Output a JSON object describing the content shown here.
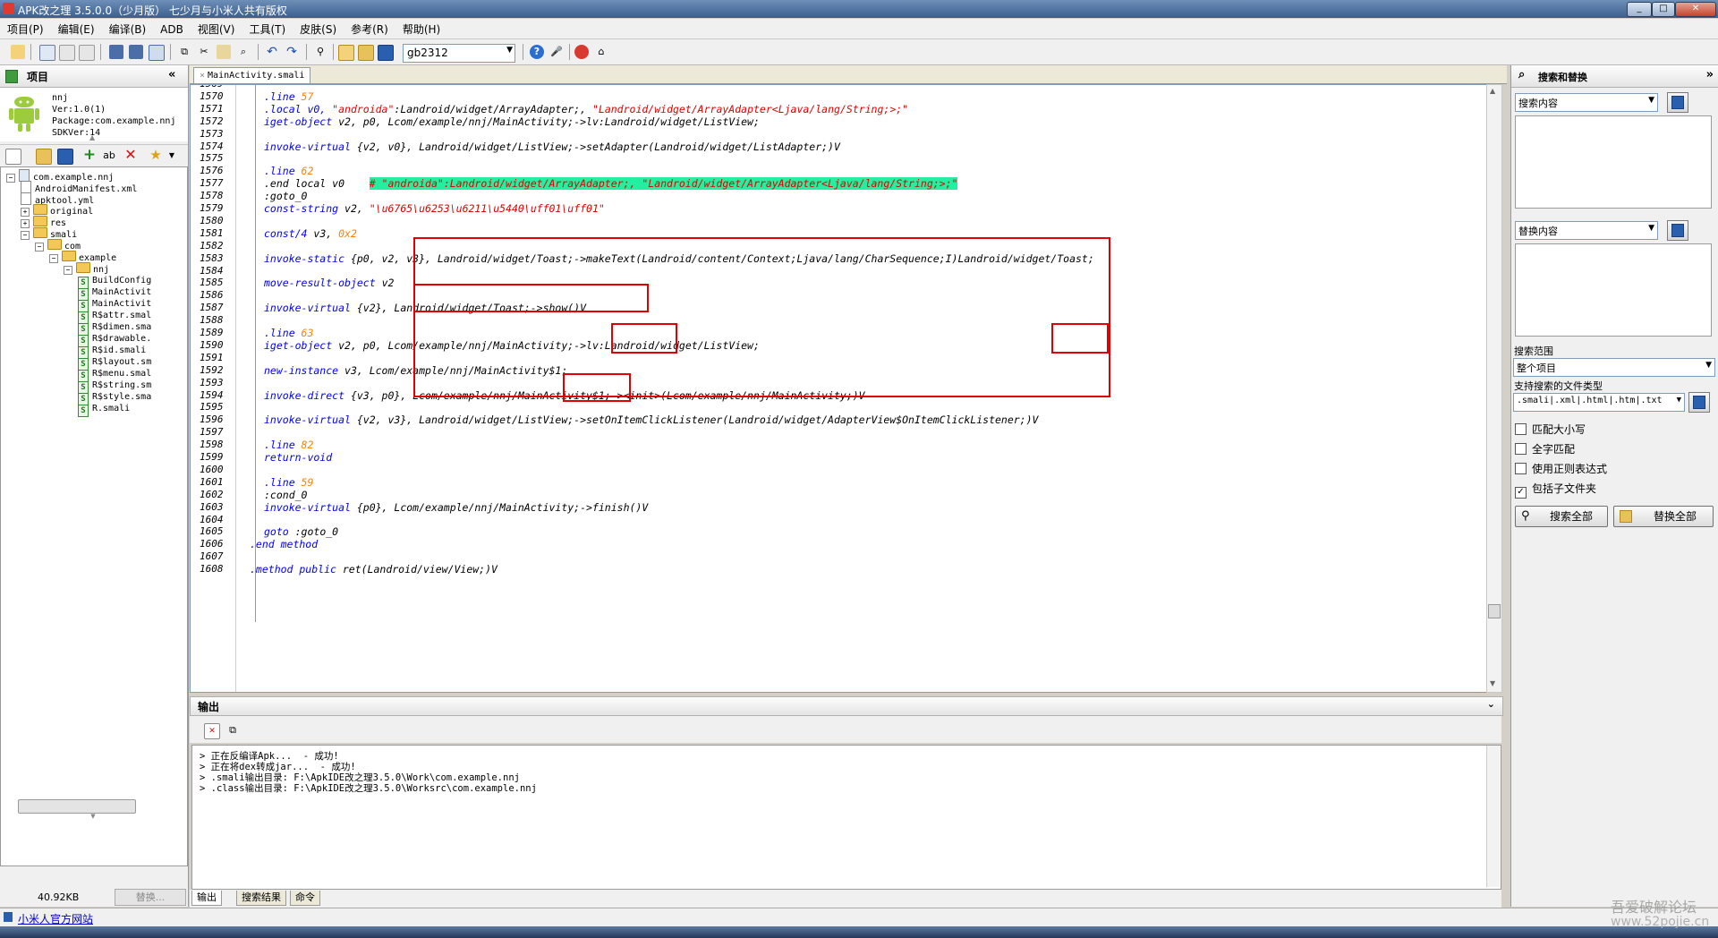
{
  "window": {
    "title": "APK改之理 3.5.0.0（少月版） 七少月与小米人共有版权"
  },
  "menu": [
    "项目(P)",
    "编辑(E)",
    "编译(B)",
    "ADB",
    "视图(V)",
    "工具(T)",
    "皮肤(S)",
    "参考(R)",
    "帮助(H)"
  ],
  "toolbar": {
    "encoding": "gb2312"
  },
  "project_panel": {
    "title": "项目",
    "info": [
      "nnj",
      "Ver:1.0(1)",
      "Package:com.example.nnj",
      "SDKVer:14"
    ],
    "tree": [
      {
        "label": "com.example.nnj",
        "kind": "root",
        "depth": 0
      },
      {
        "label": "AndroidManifest.xml",
        "kind": "file",
        "depth": 1
      },
      {
        "label": "apktool.yml",
        "kind": "file",
        "depth": 1
      },
      {
        "label": "original",
        "kind": "folder",
        "depth": 1
      },
      {
        "label": "res",
        "kind": "folder",
        "depth": 1
      },
      {
        "label": "smali",
        "kind": "folder",
        "depth": 1
      },
      {
        "label": "com",
        "kind": "folder",
        "depth": 2
      },
      {
        "label": "example",
        "kind": "folder",
        "depth": 3
      },
      {
        "label": "nnj",
        "kind": "folder",
        "depth": 4
      },
      {
        "label": "BuildConfig",
        "kind": "smali",
        "depth": 5
      },
      {
        "label": "MainActivit",
        "kind": "smali",
        "depth": 5
      },
      {
        "label": "MainActivit",
        "kind": "smali",
        "depth": 5
      },
      {
        "label": "R$attr.smal",
        "kind": "smali",
        "depth": 5
      },
      {
        "label": "R$dimen.sma",
        "kind": "smali",
        "depth": 5
      },
      {
        "label": "R$drawable.",
        "kind": "smali",
        "depth": 5
      },
      {
        "label": "R$id.smali",
        "kind": "smali",
        "depth": 5
      },
      {
        "label": "R$layout.sm",
        "kind": "smali",
        "depth": 5
      },
      {
        "label": "R$menu.smal",
        "kind": "smali",
        "depth": 5
      },
      {
        "label": "R$string.sm",
        "kind": "smali",
        "depth": 5
      },
      {
        "label": "R$style.sma",
        "kind": "smali",
        "depth": 5
      },
      {
        "label": "R.smali",
        "kind": "smali",
        "depth": 5
      }
    ],
    "status": {
      "size": "40.92KB",
      "replace_label": "替换..."
    }
  },
  "editor": {
    "tab": "MainActivity.smali",
    "lines": [
      {
        "n": "1569",
        "segs": []
      },
      {
        "n": "1570",
        "segs": [
          [
            ".line ",
            "dir"
          ],
          [
            "57",
            "num"
          ]
        ]
      },
      {
        "n": "1571",
        "segs": [
          [
            ".local v0, ",
            "dir"
          ],
          [
            "\"androida\"",
            "str"
          ],
          [
            ":Landroid/widget/ArrayAdapter;, ",
            ""
          ],
          [
            "\"Landroid/widget/ArrayAdapter<Ljava/lang/String;>;\"",
            "str"
          ]
        ]
      },
      {
        "n": "1572",
        "segs": [
          [
            "iget-object ",
            "kw"
          ],
          [
            "v2, p0, Lcom/example/nnj/MainActivity;->lv:Landroid/widget/ListView;",
            ""
          ]
        ]
      },
      {
        "n": "1573",
        "segs": []
      },
      {
        "n": "1574",
        "segs": [
          [
            "invoke-virtual ",
            "kw"
          ],
          [
            "{v2, v0}, Landroid/widget/ListView;->setAdapter(Landroid/widget/ListAdapter;)V",
            ""
          ]
        ]
      },
      {
        "n": "1575",
        "segs": []
      },
      {
        "n": "1576",
        "segs": [
          [
            ".line ",
            "dir"
          ],
          [
            "62",
            "num"
          ]
        ]
      },
      {
        "n": "1577",
        "segs": [
          [
            ".end local v0    ",
            ""
          ],
          [
            "# \"androida\":Landroid/widget/ArrayAdapter;, \"Landroid/widget/ArrayAdapter<Ljava/lang/String;>;\"",
            "cmt-hl"
          ]
        ]
      },
      {
        "n": "1578",
        "segs": [
          [
            ":goto_0",
            ""
          ]
        ]
      },
      {
        "n": "1579",
        "segs": [
          [
            "const-string ",
            "kw"
          ],
          [
            "v2, ",
            ""
          ],
          [
            "\"\\u6765\\u6253\\u6211\\u5440\\uff01\\uff01\"",
            "str"
          ]
        ]
      },
      {
        "n": "1580",
        "segs": []
      },
      {
        "n": "1581",
        "segs": [
          [
            "const/4 ",
            "kw"
          ],
          [
            "v3, ",
            ""
          ],
          [
            "0x2",
            "num"
          ]
        ]
      },
      {
        "n": "1582",
        "segs": []
      },
      {
        "n": "1583",
        "segs": [
          [
            "invoke-static ",
            "kw"
          ],
          [
            "{p0, v2, v3}, Landroid/widget/Toast;->makeText(Landroid/content/Context;Ljava/lang/CharSequence;I)Landroid/widget/Toast;",
            ""
          ]
        ]
      },
      {
        "n": "1584",
        "segs": []
      },
      {
        "n": "1585",
        "segs": [
          [
            "move-result-object ",
            "kw"
          ],
          [
            "v2",
            ""
          ]
        ]
      },
      {
        "n": "1586",
        "segs": []
      },
      {
        "n": "1587",
        "segs": [
          [
            "invoke-virtual ",
            "kw"
          ],
          [
            "{v2}, Landroid/widget/Toast;->show()V",
            ""
          ]
        ]
      },
      {
        "n": "1588",
        "segs": []
      },
      {
        "n": "1589",
        "segs": [
          [
            ".line ",
            "dir"
          ],
          [
            "63",
            "num"
          ]
        ]
      },
      {
        "n": "1590",
        "segs": [
          [
            "iget-object ",
            "kw"
          ],
          [
            "v2, p0, Lcom/example/nnj/MainActivity;->lv:Landroid/widget/ListView;",
            ""
          ]
        ]
      },
      {
        "n": "1591",
        "segs": []
      },
      {
        "n": "1592",
        "segs": [
          [
            "new-instance ",
            "kw"
          ],
          [
            "v3, Lcom/example/nnj/MainActivity$1;",
            ""
          ]
        ]
      },
      {
        "n": "1593",
        "segs": []
      },
      {
        "n": "1594",
        "segs": [
          [
            "invoke-direct ",
            "kw"
          ],
          [
            "{v3, p0}, Lcom/example/nnj/MainActivity$1;-><init>(Lcom/example/nnj/MainActivity;)V",
            ""
          ]
        ]
      },
      {
        "n": "1595",
        "segs": []
      },
      {
        "n": "1596",
        "segs": [
          [
            "invoke-virtual ",
            "kw"
          ],
          [
            "{v2, v3}, Landroid/widget/ListView;->setOnItemClickListener(Landroid/widget/AdapterView$OnItemClickListener;)V",
            ""
          ]
        ]
      },
      {
        "n": "1597",
        "segs": []
      },
      {
        "n": "1598",
        "segs": [
          [
            ".line ",
            "dir"
          ],
          [
            "82",
            "num"
          ]
        ]
      },
      {
        "n": "1599",
        "segs": [
          [
            "return-void",
            "kw"
          ]
        ]
      },
      {
        "n": "1600",
        "segs": []
      },
      {
        "n": "1601",
        "segs": [
          [
            ".line ",
            "dir"
          ],
          [
            "59",
            "num"
          ]
        ]
      },
      {
        "n": "1602",
        "segs": [
          [
            ":cond_0",
            ""
          ]
        ]
      },
      {
        "n": "1603",
        "segs": [
          [
            "invoke-virtual ",
            "kw"
          ],
          [
            "{p0}, Lcom/example/nnj/MainActivity;->finish()V",
            ""
          ]
        ]
      },
      {
        "n": "1604",
        "segs": []
      },
      {
        "n": "1605",
        "segs": [
          [
            "goto ",
            "kw"
          ],
          [
            ":goto_0",
            ""
          ]
        ]
      },
      {
        "n": "1606",
        "segs": [
          [
            ".end method",
            "dir"
          ]
        ]
      },
      {
        "n": "1607",
        "segs": []
      },
      {
        "n": "1608",
        "segs": [
          [
            ".method public ",
            "dir"
          ],
          [
            "ret(Landroid/view/View;)V",
            ""
          ]
        ]
      }
    ]
  },
  "output": {
    "title": "输出",
    "lines": [
      "> 正在反编译Apk...  - 成功!",
      "> 正在将dex转成jar...  - 成功!",
      "> .smali输出目录: F:\\ApkIDE改之理3.5.0\\Work\\com.example.nnj",
      "> .class输出目录: F:\\ApkIDE改之理3.5.0\\Worksrc\\com.example.nnj"
    ],
    "tabs": [
      "输出",
      "搜索结果",
      "命令"
    ]
  },
  "search_panel": {
    "title": "搜索和替换",
    "search_label": "搜索内容",
    "replace_label": "替换内容",
    "scope_label": "搜索范围",
    "scope_value": "整个项目",
    "filetype_label": "支持搜索的文件类型",
    "filetype_value": ".smali|.xml|.html|.htm|.txt",
    "options": [
      {
        "label": "匹配大小写",
        "checked": false
      },
      {
        "label": "全字匹配",
        "checked": false
      },
      {
        "label": "使用正则表达式",
        "checked": false
      },
      {
        "label": "包括子文件夹",
        "checked": true
      }
    ],
    "search_all": "搜索全部",
    "replace_all": "替换全部"
  },
  "statusbar": {
    "link": "小米人官方网站"
  },
  "watermark": {
    "line1": "吾爱破解论坛",
    "line2": "www.52pojie.cn"
  },
  "colors": {
    "keyword": "#0000ff",
    "string": "#e00000",
    "number": "#ff8000",
    "highlight": "#22f0a0",
    "annotation": "#e00000"
  }
}
